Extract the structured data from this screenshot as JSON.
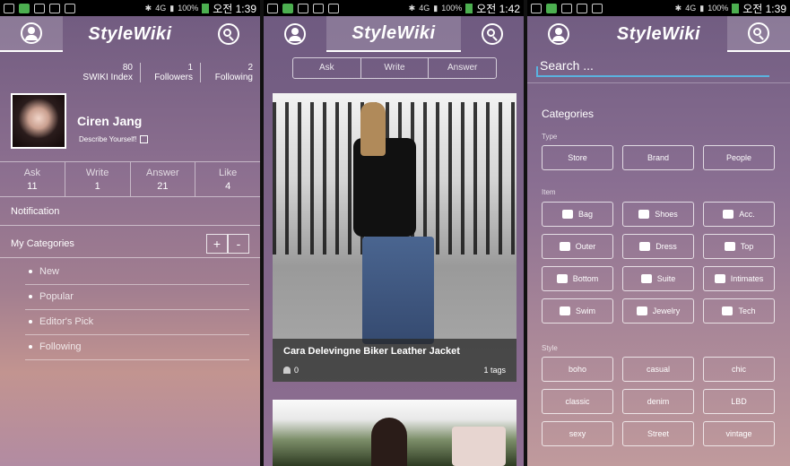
{
  "status_bars": [
    {
      "net": "4G",
      "battery": "100%",
      "time": "오전 1:39"
    },
    {
      "net": "4G",
      "battery": "100%",
      "time": "오전 1:42"
    },
    {
      "net": "4G",
      "battery": "100%",
      "time": "오전 1:39"
    }
  ],
  "app": {
    "logo": "StyleWiki"
  },
  "profile": {
    "stats": [
      {
        "value": "80",
        "label": "SWIKI Index"
      },
      {
        "value": "1",
        "label": "Followers"
      },
      {
        "value": "2",
        "label": "Following"
      }
    ],
    "name": "Ciren Jang",
    "describe": "Describe Yourself!",
    "actions": [
      {
        "label": "Ask",
        "value": "11"
      },
      {
        "label": "Write",
        "value": "1"
      },
      {
        "label": "Answer",
        "value": "21"
      },
      {
        "label": "Like",
        "value": "4"
      }
    ],
    "notification": "Notification",
    "my_categories": "My Categories",
    "plus": "+",
    "minus": "-",
    "categories": [
      "New",
      "Popular",
      "Editor's Pick",
      "Following"
    ]
  },
  "feed": {
    "segments": [
      "Ask",
      "Write",
      "Answer"
    ],
    "post": {
      "title": "Cara Delevingne Biker Leather Jacket",
      "likes": "0",
      "tags": "1 tags"
    }
  },
  "search_panel": {
    "placeholder": "Search ...",
    "categories_title": "Categories",
    "type_label": "Type",
    "types": [
      "Store",
      "Brand",
      "People"
    ],
    "item_label": "Item",
    "items": [
      {
        "label": "Bag",
        "icon": "bag-icon"
      },
      {
        "label": "Shoes",
        "icon": "shoe-icon"
      },
      {
        "label": "Acc.",
        "icon": "accessory-icon"
      },
      {
        "label": "Outer",
        "icon": "outer-icon"
      },
      {
        "label": "Dress",
        "icon": "dress-icon"
      },
      {
        "label": "Top",
        "icon": "top-icon"
      },
      {
        "label": "Bottom",
        "icon": "skirt-icon"
      },
      {
        "label": "Suite",
        "icon": "suit-icon"
      },
      {
        "label": "Intimates",
        "icon": "intimates-icon"
      },
      {
        "label": "Swim",
        "icon": "swimsuit-icon"
      },
      {
        "label": "Jewelry",
        "icon": "ring-icon"
      },
      {
        "label": "Tech",
        "icon": "device-icon"
      }
    ],
    "style_label": "Style",
    "styles": [
      "boho",
      "casual",
      "chic",
      "classic",
      "denim",
      "LBD",
      "sexy",
      "Street",
      "vintage"
    ]
  }
}
